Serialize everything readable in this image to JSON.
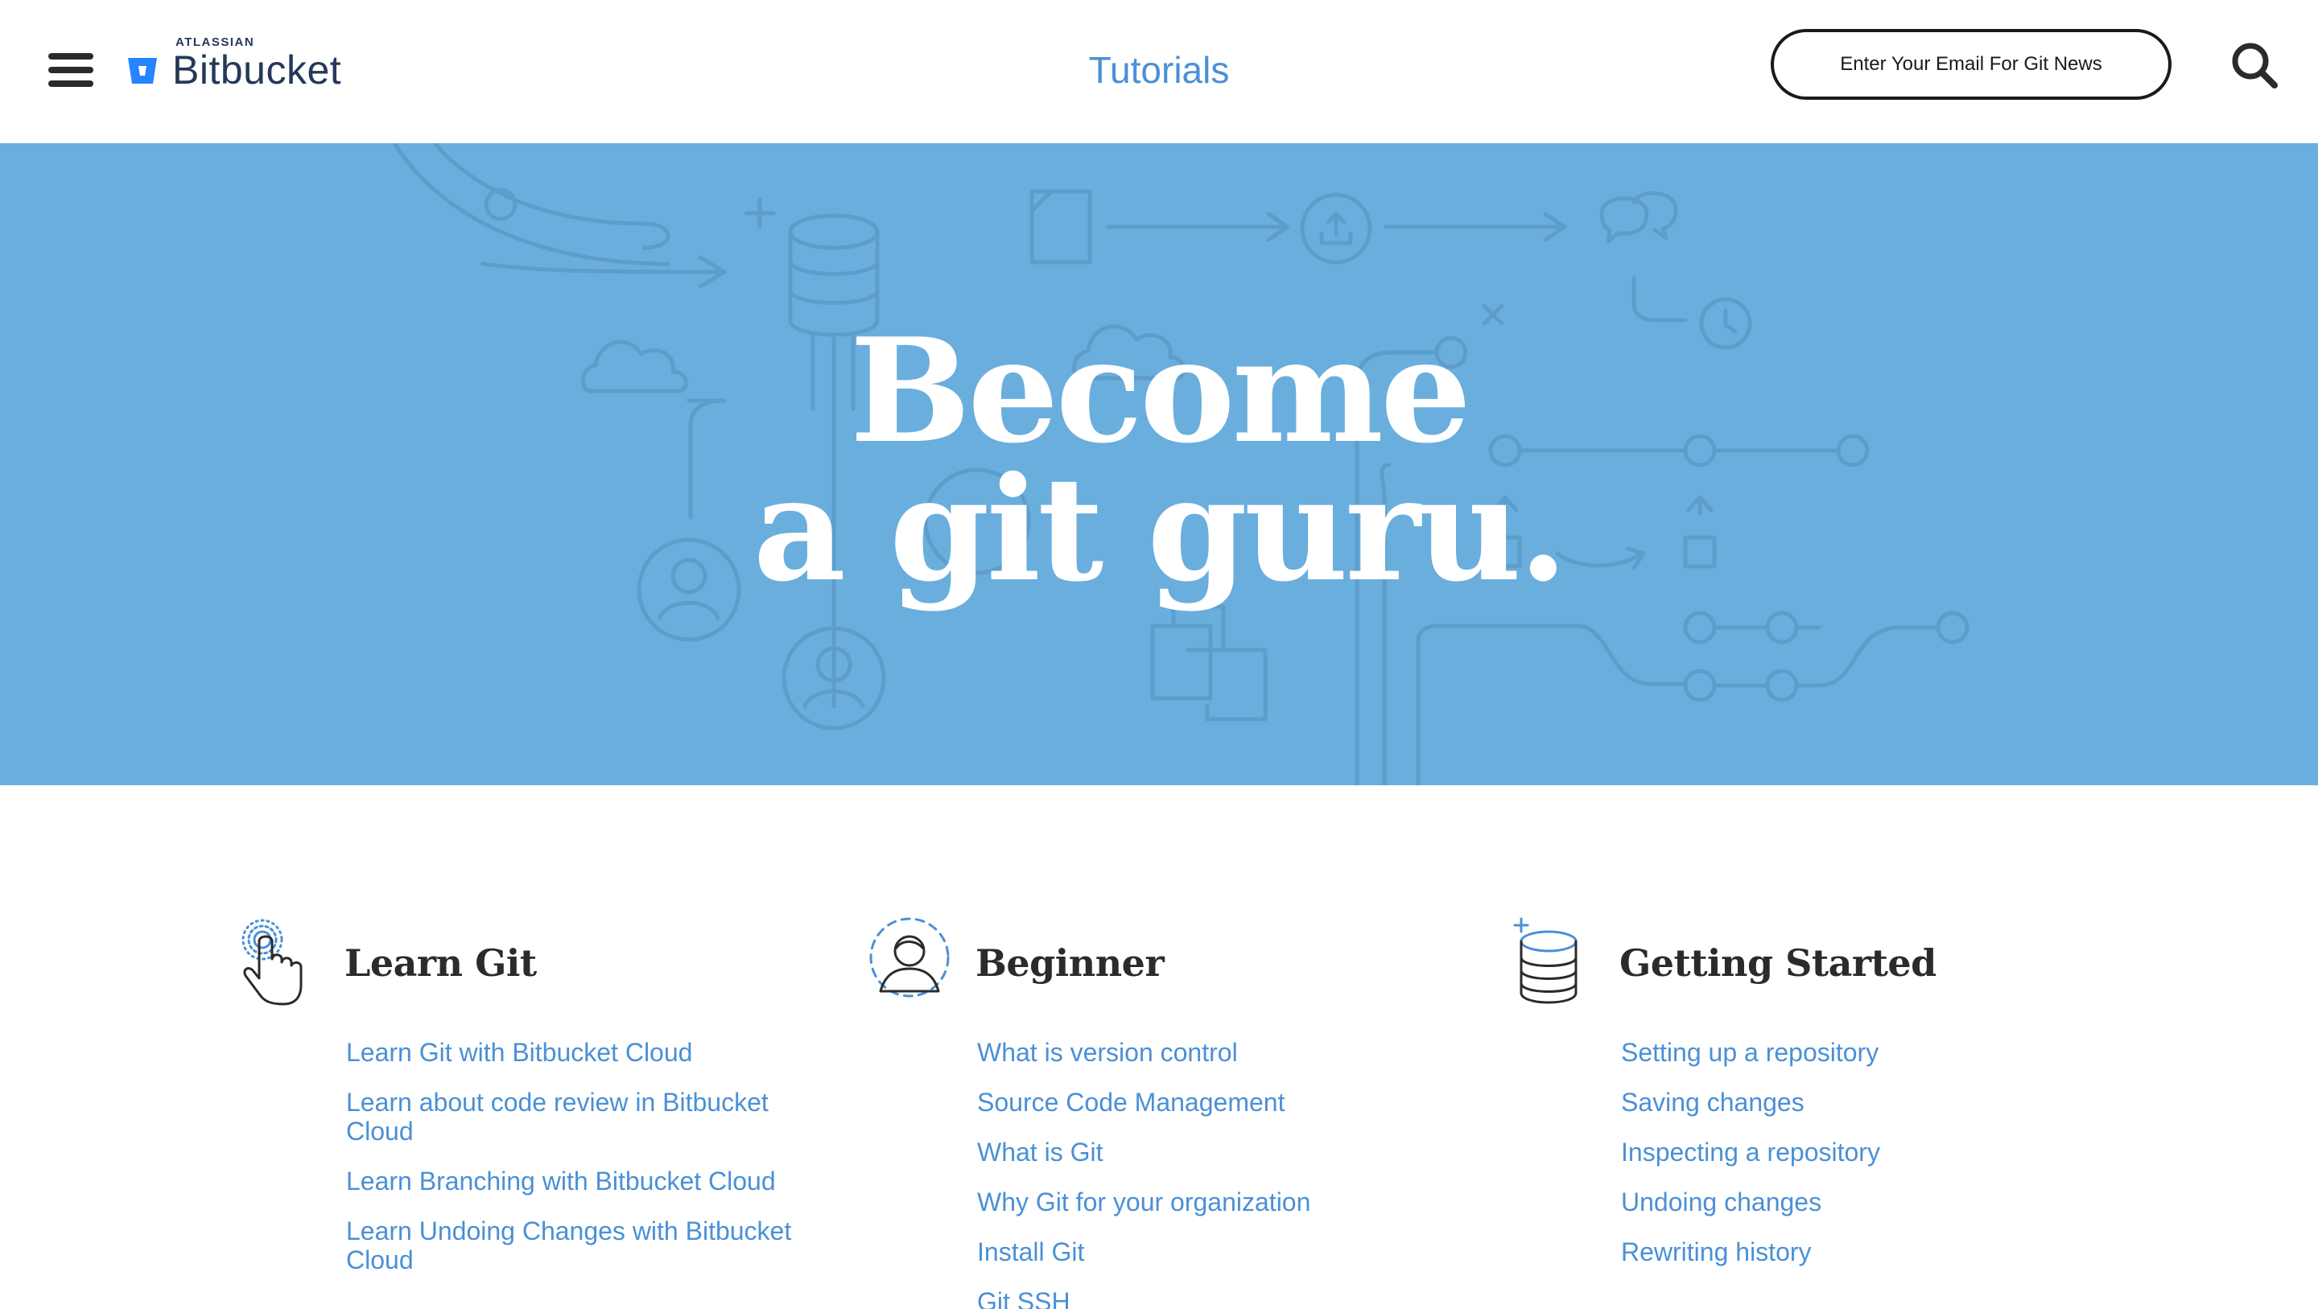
{
  "header": {
    "brand_small": "ATLASSIAN",
    "brand_name": "Bitbucket",
    "nav_title": "Tutorials",
    "email_button": "Enter Your Email For Git News",
    "menu_icon": "hamburger-menu-icon",
    "search_icon": "search-icon"
  },
  "hero": {
    "line1": "Become",
    "line2": "a git guru."
  },
  "columns": [
    {
      "icon": "pointer-hand-icon",
      "heading": "Learn Git",
      "links": [
        "Learn Git with Bitbucket Cloud",
        "Learn about code review in Bitbucket Cloud",
        "Learn Branching with Bitbucket Cloud",
        "Learn Undoing Changes with Bitbucket Cloud"
      ]
    },
    {
      "icon": "user-avatar-icon",
      "heading": "Beginner",
      "links": [
        "What is version control",
        "Source Code Management",
        "What is Git",
        "Why Git for your organization",
        "Install Git",
        "Git SSH"
      ]
    },
    {
      "icon": "database-icon",
      "heading": "Getting Started",
      "links": [
        "Setting up a repository",
        "Saving changes",
        "Inspecting a repository",
        "Undoing changes",
        "Rewriting history"
      ]
    }
  ],
  "colors": {
    "hero_bg": "#6aaedd",
    "link": "#4a90d6",
    "brand": "#2684ff"
  }
}
